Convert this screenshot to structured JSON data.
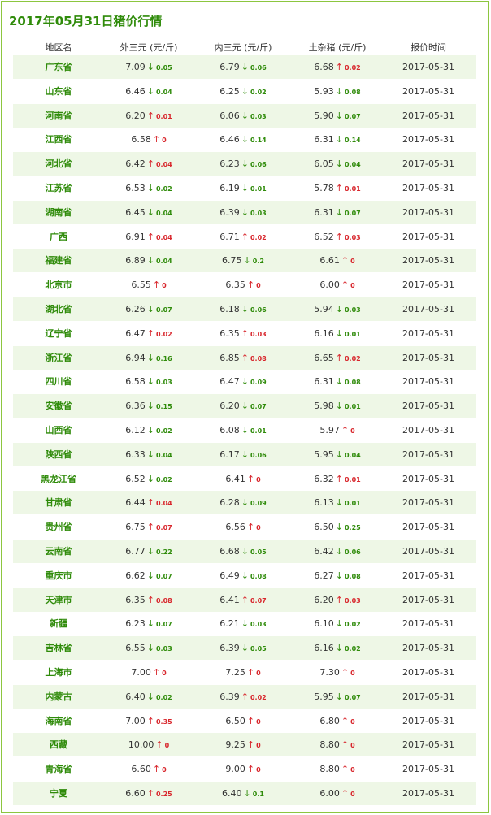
{
  "title": "2017年05月31日猪价行情",
  "chart_data": {
    "type": "table",
    "columns": [
      "地区名",
      "外三元 (元/斤)",
      "内三元 (元/斤)",
      "土杂猪 (元/斤)",
      "报价时间"
    ],
    "rows": [
      {
        "region": "广东省",
        "cells": [
          {
            "price": "7.09",
            "dir": "down",
            "change": "0.05"
          },
          {
            "price": "6.79",
            "dir": "down",
            "change": "0.06"
          },
          {
            "price": "6.68",
            "dir": "up",
            "change": "0.02"
          }
        ],
        "date": "2017-05-31"
      },
      {
        "region": "山东省",
        "cells": [
          {
            "price": "6.46",
            "dir": "down",
            "change": "0.04"
          },
          {
            "price": "6.25",
            "dir": "down",
            "change": "0.02"
          },
          {
            "price": "5.93",
            "dir": "down",
            "change": "0.08"
          }
        ],
        "date": "2017-05-31"
      },
      {
        "region": "河南省",
        "cells": [
          {
            "price": "6.20",
            "dir": "up",
            "change": "0.01"
          },
          {
            "price": "6.06",
            "dir": "down",
            "change": "0.03"
          },
          {
            "price": "5.90",
            "dir": "down",
            "change": "0.07"
          }
        ],
        "date": "2017-05-31"
      },
      {
        "region": "江西省",
        "cells": [
          {
            "price": "6.58",
            "dir": "up",
            "change": "0"
          },
          {
            "price": "6.46",
            "dir": "down",
            "change": "0.14"
          },
          {
            "price": "6.31",
            "dir": "down",
            "change": "0.14"
          }
        ],
        "date": "2017-05-31"
      },
      {
        "region": "河北省",
        "cells": [
          {
            "price": "6.42",
            "dir": "up",
            "change": "0.04"
          },
          {
            "price": "6.23",
            "dir": "down",
            "change": "0.06"
          },
          {
            "price": "6.05",
            "dir": "down",
            "change": "0.04"
          }
        ],
        "date": "2017-05-31"
      },
      {
        "region": "江苏省",
        "cells": [
          {
            "price": "6.53",
            "dir": "down",
            "change": "0.02"
          },
          {
            "price": "6.19",
            "dir": "down",
            "change": "0.01"
          },
          {
            "price": "5.78",
            "dir": "up",
            "change": "0.01"
          }
        ],
        "date": "2017-05-31"
      },
      {
        "region": "湖南省",
        "cells": [
          {
            "price": "6.45",
            "dir": "down",
            "change": "0.04"
          },
          {
            "price": "6.39",
            "dir": "down",
            "change": "0.03"
          },
          {
            "price": "6.31",
            "dir": "down",
            "change": "0.07"
          }
        ],
        "date": "2017-05-31"
      },
      {
        "region": "广西",
        "cells": [
          {
            "price": "6.91",
            "dir": "up",
            "change": "0.04"
          },
          {
            "price": "6.71",
            "dir": "up",
            "change": "0.02"
          },
          {
            "price": "6.52",
            "dir": "up",
            "change": "0.03"
          }
        ],
        "date": "2017-05-31"
      },
      {
        "region": "福建省",
        "cells": [
          {
            "price": "6.89",
            "dir": "down",
            "change": "0.04"
          },
          {
            "price": "6.75",
            "dir": "down",
            "change": "0.2"
          },
          {
            "price": "6.61",
            "dir": "up",
            "change": "0"
          }
        ],
        "date": "2017-05-31"
      },
      {
        "region": "北京市",
        "cells": [
          {
            "price": "6.55",
            "dir": "up",
            "change": "0"
          },
          {
            "price": "6.35",
            "dir": "up",
            "change": "0"
          },
          {
            "price": "6.00",
            "dir": "up",
            "change": "0"
          }
        ],
        "date": "2017-05-31"
      },
      {
        "region": "湖北省",
        "cells": [
          {
            "price": "6.26",
            "dir": "down",
            "change": "0.07"
          },
          {
            "price": "6.18",
            "dir": "down",
            "change": "0.06"
          },
          {
            "price": "5.94",
            "dir": "down",
            "change": "0.03"
          }
        ],
        "date": "2017-05-31"
      },
      {
        "region": "辽宁省",
        "cells": [
          {
            "price": "6.47",
            "dir": "up",
            "change": "0.02"
          },
          {
            "price": "6.35",
            "dir": "up",
            "change": "0.03"
          },
          {
            "price": "6.16",
            "dir": "down",
            "change": "0.01"
          }
        ],
        "date": "2017-05-31"
      },
      {
        "region": "浙江省",
        "cells": [
          {
            "price": "6.94",
            "dir": "down",
            "change": "0.16"
          },
          {
            "price": "6.85",
            "dir": "up",
            "change": "0.08"
          },
          {
            "price": "6.65",
            "dir": "up",
            "change": "0.02"
          }
        ],
        "date": "2017-05-31"
      },
      {
        "region": "四川省",
        "cells": [
          {
            "price": "6.58",
            "dir": "down",
            "change": "0.03"
          },
          {
            "price": "6.47",
            "dir": "down",
            "change": "0.09"
          },
          {
            "price": "6.31",
            "dir": "down",
            "change": "0.08"
          }
        ],
        "date": "2017-05-31"
      },
      {
        "region": "安徽省",
        "cells": [
          {
            "price": "6.36",
            "dir": "down",
            "change": "0.15"
          },
          {
            "price": "6.20",
            "dir": "down",
            "change": "0.07"
          },
          {
            "price": "5.98",
            "dir": "down",
            "change": "0.01"
          }
        ],
        "date": "2017-05-31"
      },
      {
        "region": "山西省",
        "cells": [
          {
            "price": "6.12",
            "dir": "down",
            "change": "0.02"
          },
          {
            "price": "6.08",
            "dir": "down",
            "change": "0.01"
          },
          {
            "price": "5.97",
            "dir": "up",
            "change": "0"
          }
        ],
        "date": "2017-05-31"
      },
      {
        "region": "陕西省",
        "cells": [
          {
            "price": "6.33",
            "dir": "down",
            "change": "0.04"
          },
          {
            "price": "6.17",
            "dir": "down",
            "change": "0.06"
          },
          {
            "price": "5.95",
            "dir": "down",
            "change": "0.04"
          }
        ],
        "date": "2017-05-31"
      },
      {
        "region": "黑龙江省",
        "cells": [
          {
            "price": "6.52",
            "dir": "down",
            "change": "0.02"
          },
          {
            "price": "6.41",
            "dir": "up",
            "change": "0"
          },
          {
            "price": "6.32",
            "dir": "up",
            "change": "0.01"
          }
        ],
        "date": "2017-05-31"
      },
      {
        "region": "甘肃省",
        "cells": [
          {
            "price": "6.44",
            "dir": "up",
            "change": "0.04"
          },
          {
            "price": "6.28",
            "dir": "down",
            "change": "0.09"
          },
          {
            "price": "6.13",
            "dir": "down",
            "change": "0.01"
          }
        ],
        "date": "2017-05-31"
      },
      {
        "region": "贵州省",
        "cells": [
          {
            "price": "6.75",
            "dir": "up",
            "change": "0.07"
          },
          {
            "price": "6.56",
            "dir": "up",
            "change": "0"
          },
          {
            "price": "6.50",
            "dir": "down",
            "change": "0.25"
          }
        ],
        "date": "2017-05-31"
      },
      {
        "region": "云南省",
        "cells": [
          {
            "price": "6.77",
            "dir": "down",
            "change": "0.22"
          },
          {
            "price": "6.68",
            "dir": "down",
            "change": "0.05"
          },
          {
            "price": "6.42",
            "dir": "down",
            "change": "0.06"
          }
        ],
        "date": "2017-05-31"
      },
      {
        "region": "重庆市",
        "cells": [
          {
            "price": "6.62",
            "dir": "down",
            "change": "0.07"
          },
          {
            "price": "6.49",
            "dir": "down",
            "change": "0.08"
          },
          {
            "price": "6.27",
            "dir": "down",
            "change": "0.08"
          }
        ],
        "date": "2017-05-31"
      },
      {
        "region": "天津市",
        "cells": [
          {
            "price": "6.35",
            "dir": "up",
            "change": "0.08"
          },
          {
            "price": "6.41",
            "dir": "up",
            "change": "0.07"
          },
          {
            "price": "6.20",
            "dir": "up",
            "change": "0.03"
          }
        ],
        "date": "2017-05-31"
      },
      {
        "region": "新疆",
        "cells": [
          {
            "price": "6.23",
            "dir": "down",
            "change": "0.07"
          },
          {
            "price": "6.21",
            "dir": "down",
            "change": "0.03"
          },
          {
            "price": "6.10",
            "dir": "down",
            "change": "0.02"
          }
        ],
        "date": "2017-05-31"
      },
      {
        "region": "吉林省",
        "cells": [
          {
            "price": "6.55",
            "dir": "down",
            "change": "0.03"
          },
          {
            "price": "6.39",
            "dir": "down",
            "change": "0.05"
          },
          {
            "price": "6.16",
            "dir": "down",
            "change": "0.02"
          }
        ],
        "date": "2017-05-31"
      },
      {
        "region": "上海市",
        "cells": [
          {
            "price": "7.00",
            "dir": "up",
            "change": "0"
          },
          {
            "price": "7.25",
            "dir": "up",
            "change": "0"
          },
          {
            "price": "7.30",
            "dir": "up",
            "change": "0"
          }
        ],
        "date": "2017-05-31"
      },
      {
        "region": "内蒙古",
        "cells": [
          {
            "price": "6.40",
            "dir": "down",
            "change": "0.02"
          },
          {
            "price": "6.39",
            "dir": "up",
            "change": "0.02"
          },
          {
            "price": "5.95",
            "dir": "down",
            "change": "0.07"
          }
        ],
        "date": "2017-05-31"
      },
      {
        "region": "海南省",
        "cells": [
          {
            "price": "7.00",
            "dir": "up",
            "change": "0.35"
          },
          {
            "price": "6.50",
            "dir": "up",
            "change": "0"
          },
          {
            "price": "6.80",
            "dir": "up",
            "change": "0"
          }
        ],
        "date": "2017-05-31"
      },
      {
        "region": "西藏",
        "cells": [
          {
            "price": "10.00",
            "dir": "up",
            "change": "0"
          },
          {
            "price": "9.25",
            "dir": "up",
            "change": "0"
          },
          {
            "price": "8.80",
            "dir": "up",
            "change": "0"
          }
        ],
        "date": "2017-05-31"
      },
      {
        "region": "青海省",
        "cells": [
          {
            "price": "6.60",
            "dir": "up",
            "change": "0"
          },
          {
            "price": "9.00",
            "dir": "up",
            "change": "0"
          },
          {
            "price": "8.80",
            "dir": "up",
            "change": "0"
          }
        ],
        "date": "2017-05-31"
      },
      {
        "region": "宁夏",
        "cells": [
          {
            "price": "6.60",
            "dir": "up",
            "change": "0.25"
          },
          {
            "price": "6.40",
            "dir": "down",
            "change": "0.1"
          },
          {
            "price": "6.00",
            "dir": "up",
            "change": "0"
          }
        ],
        "date": "2017-05-31"
      }
    ]
  },
  "colors": {
    "accent": "#2f8b0a",
    "up": "#d8262c",
    "down": "#2f8b0a",
    "row_alt": "#eef7e6",
    "border": "#8cc63f"
  },
  "arrows": {
    "up": "↑",
    "down": "↓"
  }
}
